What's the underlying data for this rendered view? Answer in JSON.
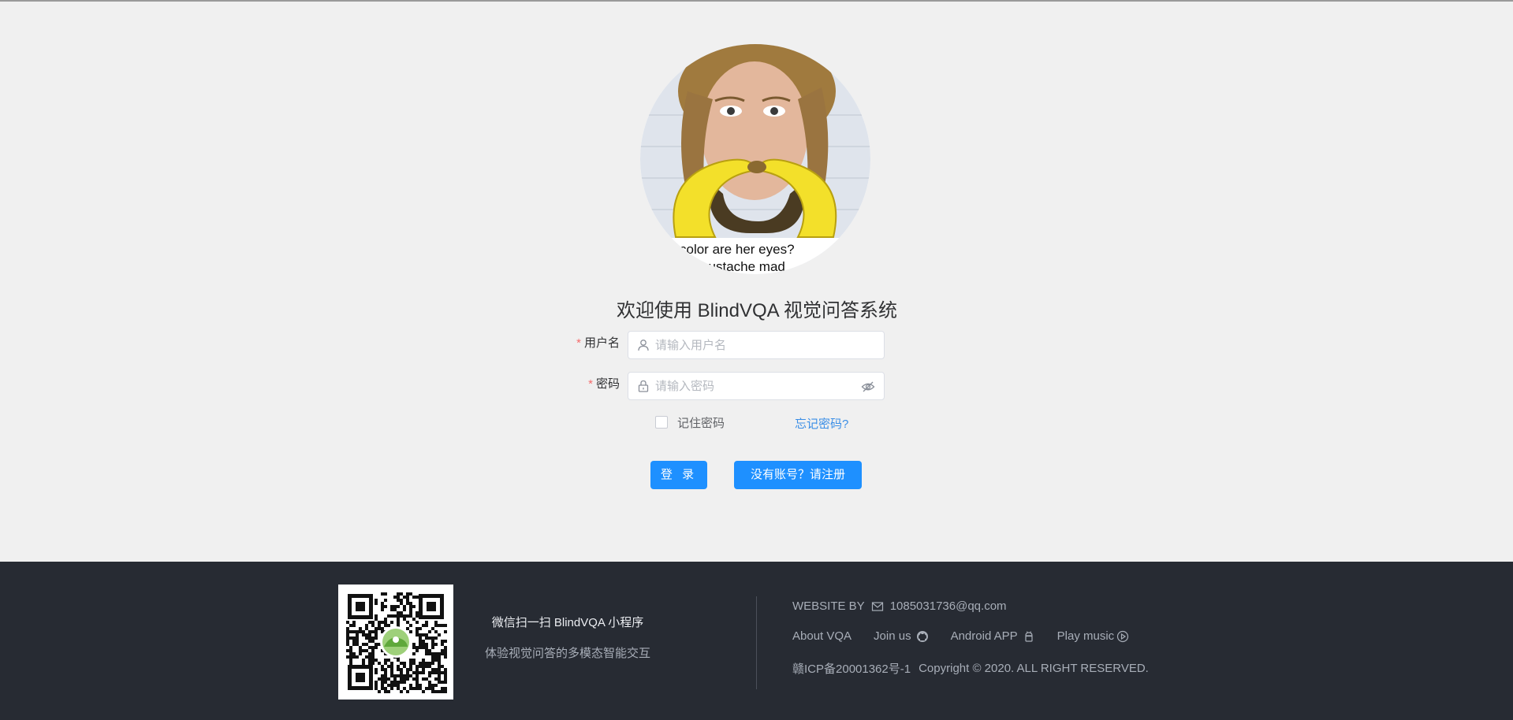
{
  "login": {
    "title": "欢迎使用 BlindVQA 视觉问答系统",
    "avatar": {
      "caption_line1": "color are her eyes?",
      "caption_line2": "the mustache mad"
    },
    "username": {
      "required_mark": "*",
      "label": "用户名",
      "placeholder": "请输入用户名",
      "value": "",
      "icon": "user-icon"
    },
    "password": {
      "required_mark": "*",
      "label": "密码",
      "placeholder": "请输入密码",
      "value": "",
      "icon": "lock-icon",
      "toggle_icon": "eye-hidden-icon"
    },
    "remember": {
      "label": "记住密码",
      "checked": false
    },
    "forgot_link": "忘记密码?",
    "login_button": "登 录",
    "register_button": "没有账号？请注册",
    "button_color": "#1e90ff"
  },
  "footer": {
    "background": "#272b33",
    "qr_title": "微信扫一扫 BlindVQA 小程序",
    "qr_desc": "体验视觉问答的多模态智能交互",
    "website_by": "WEBSITE BY",
    "email": "1085031736@qq.com",
    "links": [
      {
        "label": "About VQA",
        "icon": ""
      },
      {
        "label": "Join us",
        "icon": "github-icon"
      },
      {
        "label": "Android APP",
        "icon": "android-icon"
      },
      {
        "label": "Play music",
        "icon": "play-circle-icon"
      }
    ],
    "icp": "赣ICP备20001362号-1",
    "copyright": "Copyright © 2020. ALL RIGHT RESERVED."
  }
}
